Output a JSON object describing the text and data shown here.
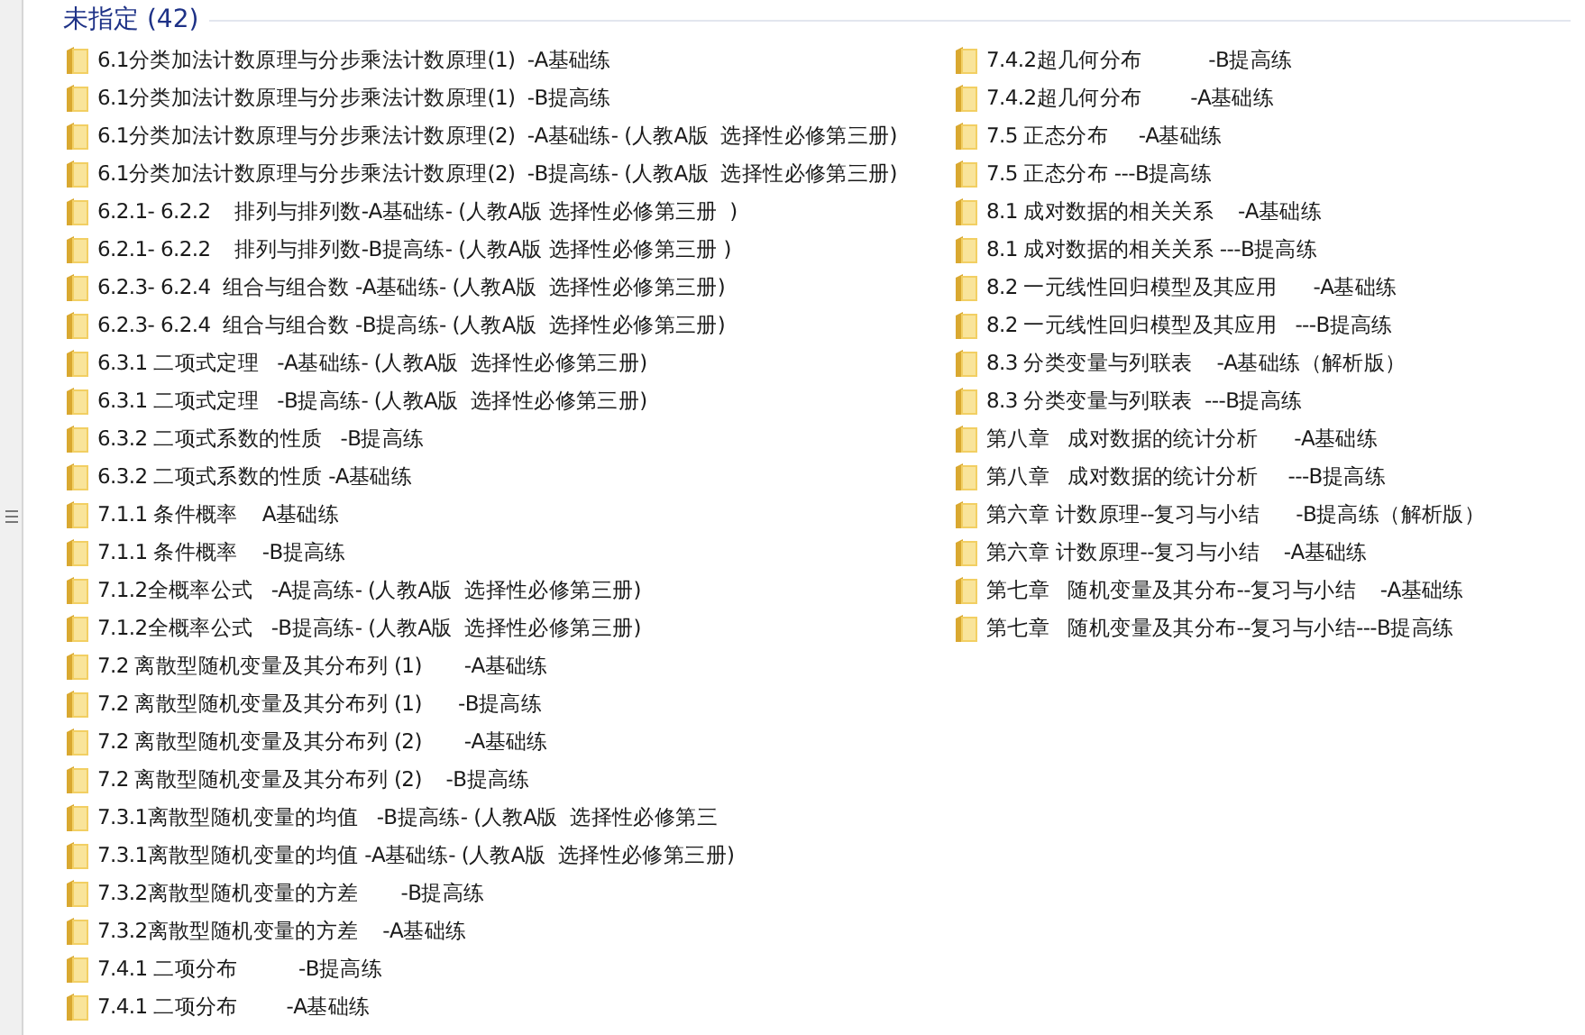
{
  "group": {
    "title": "未指定 (42)"
  },
  "columns": [
    [
      "6.1分类加法计数原理与分步乘法计数原理(1)  -A基础练",
      "6.1分类加法计数原理与分步乘法计数原理(1)  -B提高练",
      "6.1分类加法计数原理与分步乘法计数原理(2)  -A基础练- (人教A版  选择性必修第三册)",
      "6.1分类加法计数原理与分步乘法计数原理(2)  -B提高练- (人教A版  选择性必修第三册)",
      "6.2.1- 6.2.2    排列与排列数-A基础练- (人教A版 选择性必修第三册  )",
      "6.2.1- 6.2.2    排列与排列数-B提高练- (人教A版 选择性必修第三册 )",
      "6.2.3- 6.2.4  组合与组合数 -A基础练- (人教A版  选择性必修第三册)",
      "6.2.3- 6.2.4  组合与组合数 -B提高练- (人教A版  选择性必修第三册)",
      "6.3.1 二项式定理   -A基础练- (人教A版  选择性必修第三册)",
      "6.3.1 二项式定理   -B提高练- (人教A版  选择性必修第三册)",
      "6.3.2 二项式系数的性质   -B提高练",
      "6.3.2 二项式系数的性质 -A基础练",
      "7.1.1 条件概率    A基础练",
      "7.1.1 条件概率    -B提高练",
      "7.1.2全概率公式   -A提高练- (人教A版  选择性必修第三册)",
      "7.1.2全概率公式   -B提高练- (人教A版  选择性必修第三册)",
      "7.2 离散型随机变量及其分布列 (1)       -A基础练",
      "7.2 离散型随机变量及其分布列 (1)      -B提高练",
      "7.2 离散型随机变量及其分布列 (2)       -A基础练",
      "7.2 离散型随机变量及其分布列 (2)    -B提高练",
      "7.3.1离散型随机变量的均值   -B提高练- (人教A版  选择性必修第三",
      "7.3.1离散型随机变量的均值 -A基础练- (人教A版  选择性必修第三册)",
      "7.3.2离散型随机变量的方差       -B提高练",
      "7.3.2离散型随机变量的方差    -A基础练",
      "7.4.1 二项分布          -B提高练",
      "7.4.1 二项分布        -A基础练"
    ],
    [
      "7.4.2超几何分布           -B提高练",
      "7.4.2超几何分布        -A基础练",
      "7.5 正态分布     -A基础练",
      "7.5 正态分布 ---B提高练",
      "8.1 成对数据的相关关系    -A基础练",
      "8.1 成对数据的相关关系 ---B提高练",
      "8.2 一元线性回归模型及其应用      -A基础练",
      "8.2 一元线性回归模型及其应用   ---B提高练",
      "8.3 分类变量与列联表    -A基础练（解析版）",
      "8.3 分类变量与列联表  ---B提高练",
      "第八章   成对数据的统计分析      -A基础练",
      "第八章   成对数据的统计分析     ---B提高练",
      "第六章 计数原理--复习与小结      -B提高练（解析版）",
      "第六章 计数原理--复习与小结    -A基础练",
      "第七章   随机变量及其分布--复习与小结    -A基础练",
      "第七章   随机变量及其分布--复习与小结---B提高练"
    ]
  ]
}
